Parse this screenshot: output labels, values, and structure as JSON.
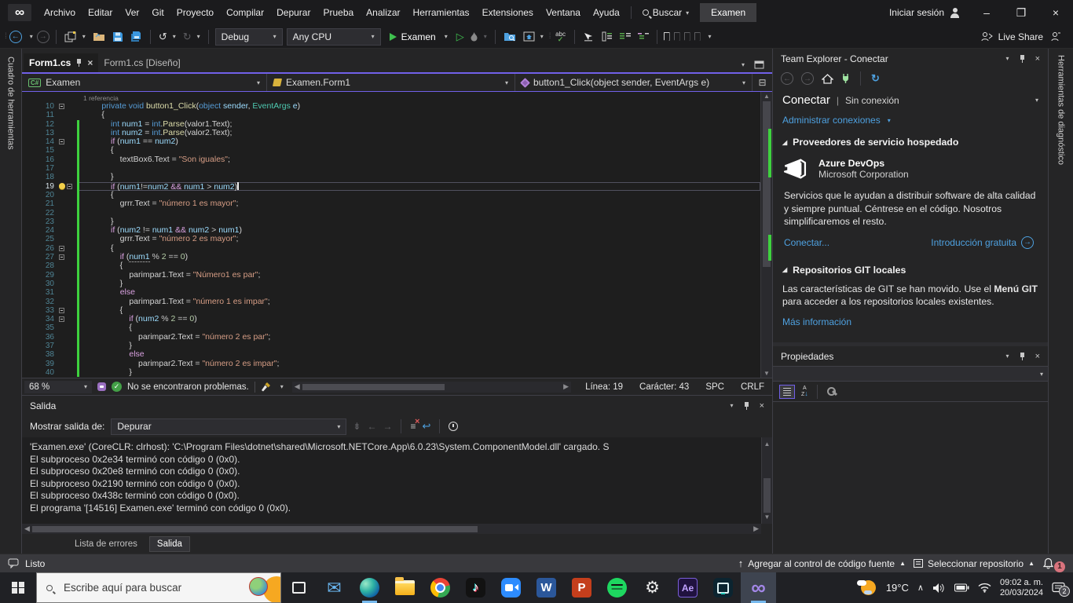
{
  "menubar": {
    "items": [
      "Archivo",
      "Editar",
      "Ver",
      "Git",
      "Proyecto",
      "Compilar",
      "Depurar",
      "Prueba",
      "Analizar",
      "Herramientas",
      "Extensiones",
      "Ventana",
      "Ayuda"
    ],
    "search_label": "Buscar",
    "solution_badge": "Examen",
    "sign_in": "Iniciar sesión",
    "window_controls": {
      "minimize": "–",
      "maximize": "❐",
      "close": "×"
    }
  },
  "toolbar": {
    "debug_target": "Debug",
    "platform": "Any CPU",
    "run_label": "Examen",
    "live_share": "Live Share"
  },
  "editor": {
    "tabs": [
      {
        "label": "Form1.cs"
      },
      {
        "label": "Form1.cs [Diseño]"
      }
    ],
    "breadcrumbs": {
      "project_icon": "C#",
      "project": "Examen",
      "type": "Examen.Form1",
      "member": "button1_Click(object sender, EventArgs e)"
    },
    "status": {
      "zoom": "68 %",
      "problems": "No se encontraron problemas.",
      "line": "Línea: 19",
      "column": "Carácter: 43",
      "spaces": "SPC",
      "eol": "CRLF"
    },
    "lines": [
      {
        "n": 10,
        "o": 1,
        "lens": "1 referencia",
        "t": [
          [
            "p",
            "        "
          ],
          [
            "k",
            "private"
          ],
          [
            "p",
            " "
          ],
          [
            "k",
            "void"
          ],
          [
            "p",
            " "
          ],
          [
            "m",
            "button1_Click"
          ],
          [
            "p",
            "("
          ],
          [
            "k",
            "object"
          ],
          [
            "p",
            " "
          ],
          [
            "v",
            "sender"
          ],
          [
            "p",
            ", "
          ],
          [
            "t",
            "EventArgs"
          ],
          [
            "p",
            " "
          ],
          [
            "v",
            "e"
          ],
          [
            "p",
            ")"
          ]
        ]
      },
      {
        "n": 11,
        "t": [
          [
            "p",
            "        {"
          ]
        ]
      },
      {
        "n": 12,
        "g": 1,
        "t": [
          [
            "p",
            "            "
          ],
          [
            "k",
            "int"
          ],
          [
            "p",
            " "
          ],
          [
            "v",
            "num1"
          ],
          [
            "o",
            " = "
          ],
          [
            "k",
            "int"
          ],
          [
            "p",
            "."
          ],
          [
            "m",
            "Parse"
          ],
          [
            "p",
            "(valor1.Text);"
          ]
        ]
      },
      {
        "n": 13,
        "g": 1,
        "t": [
          [
            "p",
            "            "
          ],
          [
            "k",
            "int"
          ],
          [
            "p",
            " "
          ],
          [
            "v",
            "num2"
          ],
          [
            "o",
            " = "
          ],
          [
            "k",
            "int"
          ],
          [
            "p",
            "."
          ],
          [
            "m",
            "Parse"
          ],
          [
            "p",
            "(valor2.Text);"
          ]
        ]
      },
      {
        "n": 14,
        "g": 1,
        "o": 1,
        "t": [
          [
            "p",
            "            "
          ],
          [
            "c",
            "if"
          ],
          [
            "p",
            " ("
          ],
          [
            "v",
            "num1"
          ],
          [
            "o",
            " == "
          ],
          [
            "v",
            "num2"
          ],
          [
            "p",
            ")"
          ]
        ]
      },
      {
        "n": 15,
        "g": 1,
        "t": [
          [
            "p",
            "            {"
          ]
        ]
      },
      {
        "n": 16,
        "g": 1,
        "t": [
          [
            "p",
            "                textBox6.Text"
          ],
          [
            "o",
            " = "
          ],
          [
            "s",
            "\"Son iguales\""
          ],
          [
            "p",
            ";"
          ]
        ]
      },
      {
        "n": 17,
        "g": 1,
        "t": []
      },
      {
        "n": 18,
        "g": 1,
        "t": [
          [
            "p",
            "            }"
          ]
        ]
      },
      {
        "n": 19,
        "g": 1,
        "o": 1,
        "cur": 1,
        "t": [
          [
            "p",
            "            "
          ],
          [
            "c",
            "if"
          ],
          [
            "p",
            " ("
          ],
          [
            "v",
            "num1"
          ],
          [
            "o",
            "!="
          ],
          [
            "v",
            "num2"
          ],
          [
            "c",
            " && "
          ],
          [
            "v",
            "num1"
          ],
          [
            "o",
            " > "
          ],
          [
            "v",
            "num2"
          ],
          [
            "p",
            ")"
          ]
        ]
      },
      {
        "n": 20,
        "g": 1,
        "t": [
          [
            "p",
            "            {"
          ]
        ]
      },
      {
        "n": 21,
        "g": 1,
        "t": [
          [
            "p",
            "                grrr.Text"
          ],
          [
            "o",
            " = "
          ],
          [
            "s",
            "\"número 1 es mayor\""
          ],
          [
            "p",
            ";"
          ]
        ]
      },
      {
        "n": 22,
        "g": 1,
        "t": []
      },
      {
        "n": 23,
        "g": 1,
        "t": [
          [
            "p",
            "            }"
          ]
        ]
      },
      {
        "n": 24,
        "g": 1,
        "t": [
          [
            "p",
            "            "
          ],
          [
            "c",
            "if"
          ],
          [
            "p",
            " ("
          ],
          [
            "v",
            "num2"
          ],
          [
            "o",
            " != "
          ],
          [
            "v",
            "num1"
          ],
          [
            "c",
            " && "
          ],
          [
            "v",
            "num2"
          ],
          [
            "o",
            " > "
          ],
          [
            "v",
            "num1"
          ],
          [
            "p",
            ")"
          ]
        ]
      },
      {
        "n": 25,
        "g": 1,
        "t": [
          [
            "p",
            "                grrr.Text"
          ],
          [
            "o",
            " = "
          ],
          [
            "s",
            "\"número 2 es mayor\""
          ],
          [
            "p",
            ";"
          ]
        ]
      },
      {
        "n": 26,
        "g": 1,
        "o": 1,
        "t": [
          [
            "p",
            "            {"
          ]
        ]
      },
      {
        "n": 27,
        "g": 1,
        "o": 1,
        "t": [
          [
            "p",
            "                "
          ],
          [
            "c",
            "if"
          ],
          [
            "p",
            " ("
          ],
          [
            "d",
            "num1"
          ],
          [
            "o",
            " % "
          ],
          [
            "u",
            "2"
          ],
          [
            "o",
            " == "
          ],
          [
            "u",
            "0"
          ],
          [
            "p",
            ")"
          ]
        ]
      },
      {
        "n": 28,
        "g": 1,
        "t": [
          [
            "p",
            "                {"
          ]
        ]
      },
      {
        "n": 29,
        "g": 1,
        "t": [
          [
            "p",
            "                    parimpar1.Text"
          ],
          [
            "o",
            " = "
          ],
          [
            "s",
            "\"Número1 es par\""
          ],
          [
            "p",
            ";"
          ]
        ]
      },
      {
        "n": 30,
        "g": 1,
        "t": [
          [
            "p",
            "                }"
          ]
        ]
      },
      {
        "n": 31,
        "g": 1,
        "t": [
          [
            "p",
            "                "
          ],
          [
            "c",
            "else"
          ]
        ]
      },
      {
        "n": 32,
        "g": 1,
        "t": [
          [
            "p",
            "                    parimpar1.Text"
          ],
          [
            "o",
            " = "
          ],
          [
            "s",
            "\"número 1 es impar\""
          ],
          [
            "p",
            ";"
          ]
        ]
      },
      {
        "n": 33,
        "g": 1,
        "o": 1,
        "t": [
          [
            "p",
            "                {"
          ]
        ]
      },
      {
        "n": 34,
        "g": 1,
        "o": 1,
        "t": [
          [
            "p",
            "                    "
          ],
          [
            "c",
            "if"
          ],
          [
            "p",
            " ("
          ],
          [
            "v",
            "num2"
          ],
          [
            "o",
            " % "
          ],
          [
            "u",
            "2"
          ],
          [
            "o",
            " == "
          ],
          [
            "u",
            "0"
          ],
          [
            "p",
            ")"
          ]
        ]
      },
      {
        "n": 35,
        "g": 1,
        "t": [
          [
            "p",
            "                    {"
          ]
        ]
      },
      {
        "n": 36,
        "g": 1,
        "t": [
          [
            "p",
            "                        parimpar2.Text"
          ],
          [
            "o",
            " = "
          ],
          [
            "s",
            "\"número 2 es par\""
          ],
          [
            "p",
            ";"
          ]
        ]
      },
      {
        "n": 37,
        "g": 1,
        "t": [
          [
            "p",
            "                    }"
          ]
        ]
      },
      {
        "n": 38,
        "g": 1,
        "t": [
          [
            "p",
            "                    "
          ],
          [
            "c",
            "else"
          ]
        ]
      },
      {
        "n": 39,
        "g": 1,
        "t": [
          [
            "p",
            "                        parimpar2.Text"
          ],
          [
            "o",
            " = "
          ],
          [
            "s",
            "\"número 2 es impar\""
          ],
          [
            "p",
            ";"
          ]
        ]
      },
      {
        "n": 40,
        "g": 1,
        "t": [
          [
            "p",
            "                    }"
          ]
        ]
      }
    ]
  },
  "team_explorer": {
    "title": "Team Explorer - Conectar",
    "heading": "Conectar",
    "heading_sep": "|",
    "connection_status": "Sin conexión",
    "manage_link": "Administrar conexiones",
    "hosted_section": "Proveedores de servicio hospedado",
    "azure": {
      "name": "Azure DevOps",
      "vendor": "Microsoft Corporation",
      "description": "Servicios que le ayudan a distribuir software de alta calidad y siempre puntual. Céntrese en el código. Nosotros simplificaremos el resto.",
      "connect_link": "Conectar...",
      "intro_link": "Introducción gratuita"
    },
    "git_section": "Repositorios GIT locales",
    "git_text_pre": "Las características de GIT se han movido. Use el ",
    "git_text_bold": "Menú GIT",
    "git_text_post": " para acceder a los repositorios locales existentes.",
    "more_info_link": "Más información"
  },
  "properties_panel": {
    "title": "Propiedades"
  },
  "output": {
    "title": "Salida",
    "source_label": "Mostrar salida de:",
    "source_value": "Depurar",
    "lines": [
      "'Examen.exe' (CoreCLR: clrhost): 'C:\\Program Files\\dotnet\\shared\\Microsoft.NETCore.App\\6.0.23\\System.ComponentModel.dll' cargado. S",
      "El subproceso 0x2e34 terminó con código 0 (0x0).",
      "El subproceso 0x20e8 terminó con código 0 (0x0).",
      "El subproceso 0x2190 terminó con código 0 (0x0).",
      "El subproceso 0x438c terminó con código 0 (0x0).",
      "El programa '[14516] Examen.exe' terminó con código 0 (0x0)."
    ],
    "tabs": [
      "Lista de errores",
      "Salida"
    ]
  },
  "status_bar": {
    "ready": "Listo",
    "source_control": "Agregar al control de código fuente",
    "select_repo": "Seleccionar repositorio",
    "bell_badge": "1"
  },
  "side_tabs": {
    "left": "Cuadro de herramientas",
    "right": "Herramientas de diagnóstico"
  },
  "taskbar": {
    "search_placeholder": "Escribe aquí para buscar",
    "apps": [
      {
        "name": "task-view",
        "cls": "ti-taskview"
      },
      {
        "name": "mail",
        "cls": "ti-mail",
        "glyph": "✉"
      },
      {
        "name": "edge",
        "cls": "ti-edge",
        "running": true
      },
      {
        "name": "file-explorer",
        "cls": "ti-explorer"
      },
      {
        "name": "chrome",
        "cls": "ti-chrome"
      },
      {
        "name": "tiktok",
        "cls": "ti-tiktok",
        "glyph": "♪"
      },
      {
        "name": "zoom",
        "cls": "ti-zoom"
      },
      {
        "name": "word",
        "cls": "ti-word",
        "glyph": "W"
      },
      {
        "name": "powerpoint",
        "cls": "ti-ppt",
        "glyph": "P"
      },
      {
        "name": "spotify",
        "cls": "ti-spotify"
      },
      {
        "name": "settings",
        "cls": "ti-settings",
        "glyph": "⚙"
      },
      {
        "name": "after-effects",
        "cls": "ti-ae",
        "glyph": "Ae"
      },
      {
        "name": "premiere-rush",
        "cls": "ti-rush"
      },
      {
        "name": "visual-studio",
        "cls": "ti-vs",
        "glyph": "∞",
        "running": true,
        "active": true
      }
    ],
    "tray": {
      "temperature": "19°C",
      "time": "09:02 a. m.",
      "date": "20/03/2024",
      "notification_count": "2"
    }
  },
  "colors": {
    "accent_purple": "#7160e8",
    "run_green": "#3fc14f",
    "link_blue": "#4ea1e0",
    "change_green": "#3ed13e"
  }
}
